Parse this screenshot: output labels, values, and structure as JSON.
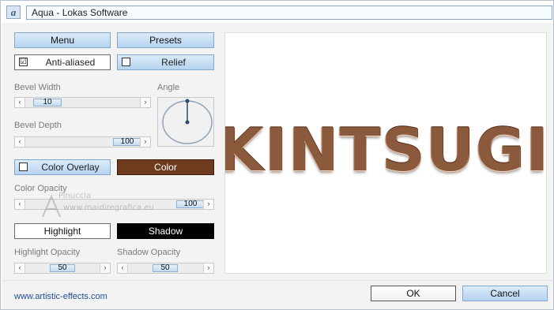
{
  "window": {
    "title": "Aqua - Lokas Software",
    "icon": "app-logo-icon"
  },
  "buttons": {
    "menu": "Menu",
    "presets": "Presets",
    "color": "Color",
    "highlight": "Highlight",
    "shadow": "Shadow",
    "ok": "OK",
    "cancel": "Cancel"
  },
  "checkboxes": {
    "anti_aliased": {
      "label": "Anti-aliased",
      "checked": true,
      "mark": "☑"
    },
    "relief": {
      "label": "Relief",
      "checked": false
    },
    "color_overlay": {
      "label": "Color Overlay",
      "checked": false
    }
  },
  "labels": {
    "bevel_width": "Bevel Width",
    "angle": "Angle",
    "bevel_depth": "Bevel Depth",
    "color_opacity": "Color Opacity",
    "highlight_opacity": "Highlight Opacity",
    "shadow_opacity": "Shadow Opacity"
  },
  "sliders": {
    "bevel_width": {
      "value": "10",
      "fraction": 0.1
    },
    "bevel_depth": {
      "value": "100",
      "fraction": 1.0
    },
    "color_opacity": {
      "value": "100",
      "fraction": 1.0
    },
    "highlight_opacity": {
      "value": "50",
      "fraction": 0.5
    },
    "shadow_opacity": {
      "value": "50",
      "fraction": 0.5
    }
  },
  "colors": {
    "color_swatch": "#6e3b1f",
    "highlight_swatch": "#ffffff",
    "shadow_swatch": "#000000",
    "accent": "#b5d3ef"
  },
  "preview": {
    "text": "KINTSUGI"
  },
  "watermark": {
    "line1": "Pinuccia",
    "line2": "www.maidiregrafica.eu"
  },
  "footer": {
    "link": "www.artistic-effects.com"
  }
}
